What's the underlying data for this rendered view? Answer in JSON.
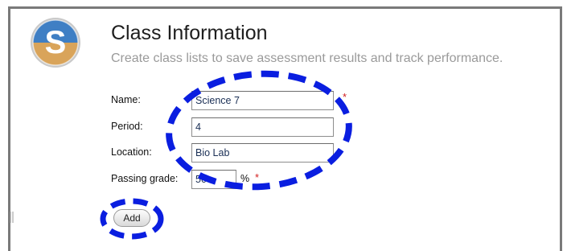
{
  "header": {
    "title": "Class Information",
    "subtitle": "Create class lists to save assessment results and track performance.",
    "logo_letter": "S"
  },
  "form": {
    "name": {
      "label": "Name:",
      "value": "Science 7",
      "required": "*"
    },
    "period": {
      "label": "Period:",
      "value": "4"
    },
    "location": {
      "label": "Location:",
      "value": "Bio Lab"
    },
    "passing_grade": {
      "label": "Passing grade:",
      "value": "50",
      "unit": "%",
      "required": "*"
    }
  },
  "actions": {
    "add_label": "Add"
  },
  "colors": {
    "annotation": "#0a1ee0",
    "required": "#d21f1f",
    "logo_blue": "#3f7fc4",
    "logo_orange": "#d9a45a"
  }
}
